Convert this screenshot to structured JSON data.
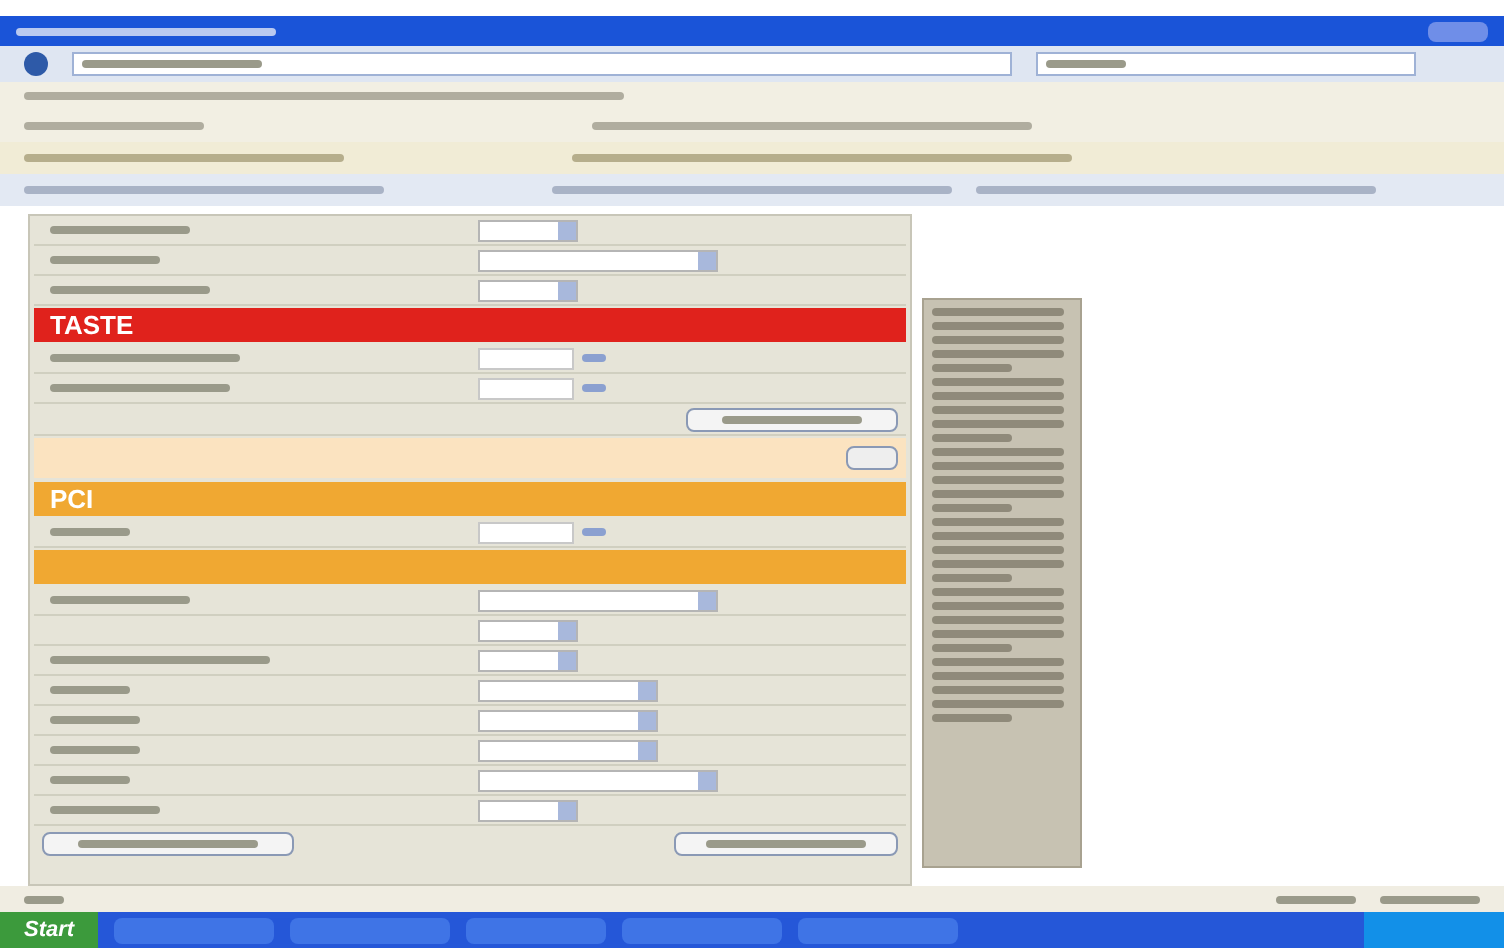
{
  "form": [
    {
      "kind": "select"
    },
    {
      "kind": "select"
    },
    {
      "kind": "select"
    },
    {
      "kind": "band",
      "title": "TASTE",
      "color": "#e0221c"
    },
    {
      "kind": "input"
    },
    {
      "kind": "input"
    },
    {
      "kind": "button"
    },
    {
      "kind": "peach"
    },
    {
      "kind": "band",
      "title": "PCI",
      "color": "#f0a832"
    },
    {
      "kind": "input"
    },
    {
      "kind": "band",
      "color": "#f0a832"
    },
    {
      "kind": "select"
    },
    {
      "kind": "select"
    },
    {
      "kind": "select"
    },
    {
      "kind": "select"
    },
    {
      "kind": "select"
    },
    {
      "kind": "select"
    },
    {
      "kind": "select"
    },
    {
      "kind": "select"
    },
    {
      "kind": "buttons"
    }
  ],
  "taskbar": {
    "start_label": "Start"
  }
}
